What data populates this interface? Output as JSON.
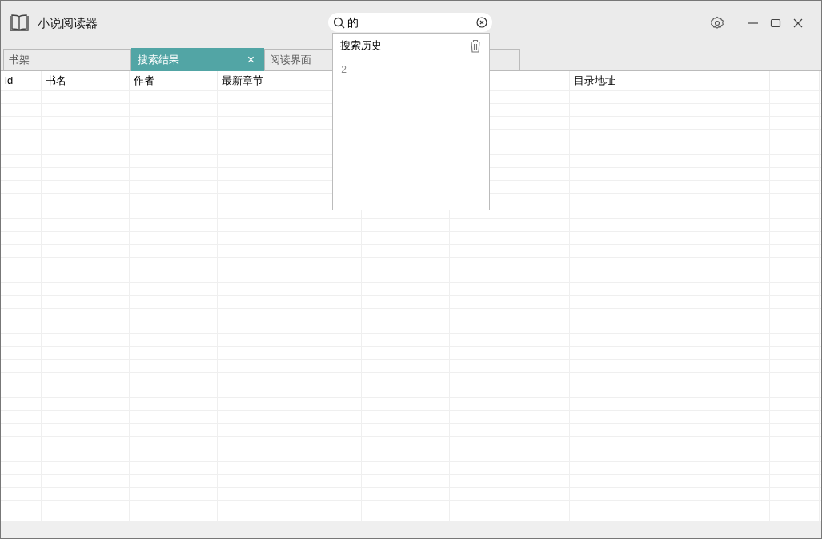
{
  "window": {
    "title": "小说阅读器"
  },
  "search": {
    "value": "的"
  },
  "tabs": [
    {
      "label": "书架",
      "selected": false
    },
    {
      "label": "搜索结果",
      "selected": true,
      "close": "×"
    },
    {
      "label": "阅读界面",
      "selected": false
    }
  ],
  "table": {
    "columns": [
      "id",
      "书名",
      "作者",
      "最新章节",
      "",
      "",
      "目录地址",
      ""
    ]
  },
  "search_history": {
    "title": "搜索历史",
    "items": [
      "2"
    ]
  }
}
